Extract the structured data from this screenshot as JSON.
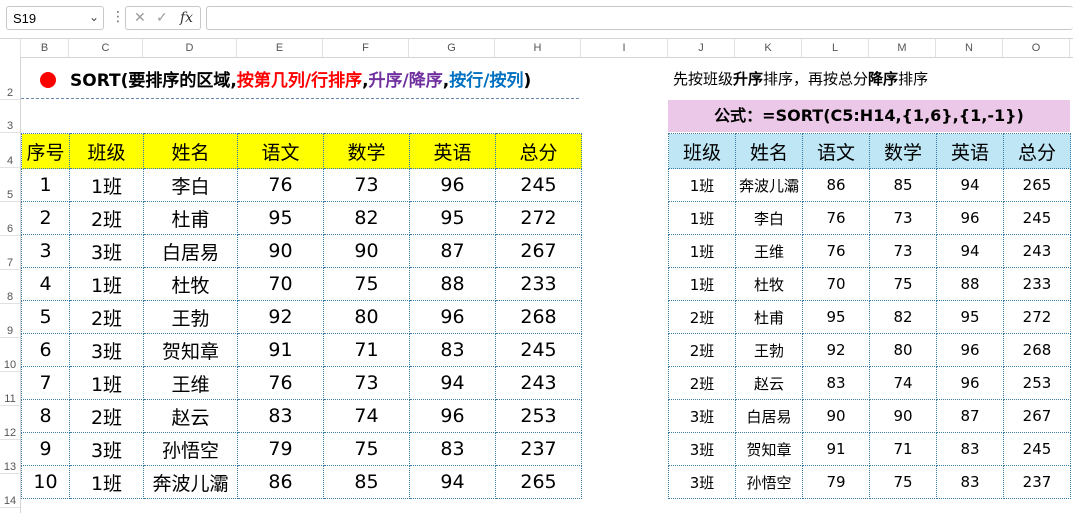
{
  "formula_bar": {
    "name_box": "S19",
    "fx_label": "fx",
    "formula": ""
  },
  "columns": [
    "B",
    "C",
    "D",
    "E",
    "F",
    "G",
    "H",
    "I",
    "J",
    "K",
    "L",
    "M",
    "N",
    "O"
  ],
  "rows": [
    "2",
    "3",
    "4",
    "5",
    "6",
    "7",
    "8",
    "9",
    "10",
    "11",
    "12",
    "13",
    "14"
  ],
  "headline": {
    "part1": "SORT(要排序的区域,",
    "part2": "按第几列/行排序",
    "part3": ",",
    "part4": "升序/降序",
    "part5": ",",
    "part6": "按行/按列",
    "part7": ")"
  },
  "description": {
    "a": "先按班级",
    "b": "升序",
    "c": "排序，再按总分",
    "d": "降序",
    "e": "排序"
  },
  "formula_label": "公式：=SORT(C5:H14,{1,6},{1,-1})",
  "colors": {
    "bullet": "#ff0000",
    "header_yellow": "#ffff00",
    "header_blue": "#bfe6f5",
    "formula_bg": "#ecc8e8"
  },
  "left_table": {
    "headers": [
      "序号",
      "班级",
      "姓名",
      "语文",
      "数学",
      "英语",
      "总分"
    ],
    "rows": [
      [
        "1",
        "1班",
        "李白",
        "76",
        "73",
        "96",
        "245"
      ],
      [
        "2",
        "2班",
        "杜甫",
        "95",
        "82",
        "95",
        "272"
      ],
      [
        "3",
        "3班",
        "白居易",
        "90",
        "90",
        "87",
        "267"
      ],
      [
        "4",
        "1班",
        "杜牧",
        "70",
        "75",
        "88",
        "233"
      ],
      [
        "5",
        "2班",
        "王勃",
        "92",
        "80",
        "96",
        "268"
      ],
      [
        "6",
        "3班",
        "贺知章",
        "91",
        "71",
        "83",
        "245"
      ],
      [
        "7",
        "1班",
        "王维",
        "76",
        "73",
        "94",
        "243"
      ],
      [
        "8",
        "2班",
        "赵云",
        "83",
        "74",
        "96",
        "253"
      ],
      [
        "9",
        "3班",
        "孙悟空",
        "79",
        "75",
        "83",
        "237"
      ],
      [
        "10",
        "1班",
        "奔波儿灞",
        "86",
        "85",
        "94",
        "265"
      ]
    ]
  },
  "right_table": {
    "headers": [
      "班级",
      "姓名",
      "语文",
      "数学",
      "英语",
      "总分"
    ],
    "rows": [
      [
        "1班",
        "奔波儿灞",
        "86",
        "85",
        "94",
        "265"
      ],
      [
        "1班",
        "李白",
        "76",
        "73",
        "96",
        "245"
      ],
      [
        "1班",
        "王维",
        "76",
        "73",
        "94",
        "243"
      ],
      [
        "1班",
        "杜牧",
        "70",
        "75",
        "88",
        "233"
      ],
      [
        "2班",
        "杜甫",
        "95",
        "82",
        "95",
        "272"
      ],
      [
        "2班",
        "王勃",
        "92",
        "80",
        "96",
        "268"
      ],
      [
        "2班",
        "赵云",
        "83",
        "74",
        "96",
        "253"
      ],
      [
        "3班",
        "白居易",
        "90",
        "90",
        "87",
        "267"
      ],
      [
        "3班",
        "贺知章",
        "91",
        "71",
        "83",
        "245"
      ],
      [
        "3班",
        "孙悟空",
        "79",
        "75",
        "83",
        "237"
      ]
    ]
  }
}
